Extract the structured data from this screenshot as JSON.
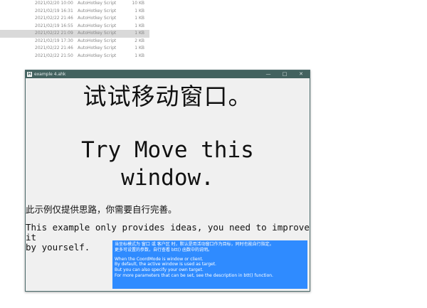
{
  "file_list": [
    {
      "date": "2021/02/20 10:00",
      "type": "AutoHotkey Script",
      "size": "10 KB",
      "selected": false
    },
    {
      "date": "2021/02/19 16:31",
      "type": "AutoHotkey Script",
      "size": "1 KB",
      "selected": false
    },
    {
      "date": "2021/02/22 21:46",
      "type": "AutoHotkey Script",
      "size": "1 KB",
      "selected": false
    },
    {
      "date": "2021/02/19 16:55",
      "type": "AutoHotkey Script",
      "size": "1 KB",
      "selected": false
    },
    {
      "date": "2021/02/22 21:09",
      "type": "AutoHotkey Script",
      "size": "1 KB",
      "selected": true
    },
    {
      "date": "2021/02/19 17:30",
      "type": "AutoHotkey Script",
      "size": "2 KB",
      "selected": false
    },
    {
      "date": "2021/02/22 21:46",
      "type": "AutoHotkey Script",
      "size": "1 KB",
      "selected": false
    },
    {
      "date": "2021/02/22 21:50",
      "type": "AutoHotkey Script",
      "size": "1 KB",
      "selected": false
    }
  ],
  "window": {
    "title": "example 4.ahk",
    "icon_letter": "H",
    "controls": {
      "minimize": "—",
      "maximize": "□",
      "close": "✕"
    },
    "titlebar_color": "#43625f",
    "big_cn": "试试移动窗口。",
    "big_en_line1": "Try Move this",
    "big_en_line2": "window.",
    "small_cn": "此示例仅提供思路，你需要自行完善。",
    "small_en_line1": "This example only provides ideas, you need to improve it",
    "small_en_line2": "by yourself."
  },
  "tooltip": {
    "background": "#2f8bff",
    "lines_cn": [
      "当坐标模式为 窗口 或 客户区 时，默认是用活动窗口作为目标，同时也能自行指定。",
      "更多可设置的参数，自行查看 btt() 函数中的说明。"
    ],
    "lines_en": [
      "When the CoordMode is window or client.",
      "By default, the active window is used as target.",
      "But you can also specify your own target.",
      "For more parameters that can be set, see the description in btt() function."
    ]
  }
}
